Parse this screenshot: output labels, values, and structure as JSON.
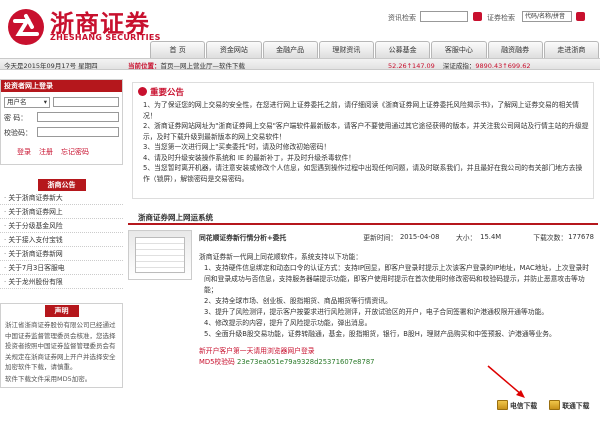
{
  "header": {
    "brand_cn": "浙商证券",
    "brand_en": "ZHESHANG SECURITIES",
    "search_info_label": "资讯检索",
    "search_code_label": "证券检索",
    "search_code_placeholder": "代码/名称/拼音"
  },
  "nav": {
    "tabs": [
      "首 页",
      "资金网站",
      "金融产品",
      "理财资讯",
      "公募基金",
      "客服中心",
      "融资融券",
      "走进浙商"
    ]
  },
  "topbar": {
    "date": "今天是2015年09月17号 星期四",
    "breadcrumb_label": "当前位置：",
    "breadcrumb_path": "首页—网上营业厅—软件下载",
    "ticker1": "52.26↑147.09",
    "ticker2_label": "深证成指：",
    "ticker2": "9890.43↑699.62"
  },
  "login": {
    "title": "投资者网上登录",
    "account_type": "用户名",
    "password_label": "密  码：",
    "captcha_label": "校验码：",
    "links": [
      "登录",
      "注册",
      "忘记密码"
    ]
  },
  "notices": {
    "title": "浙商公告",
    "items": [
      "关于浙商证券新大",
      "关于浙商证券网上",
      "关于分级基金风险",
      "关于接入支付宝钱",
      "关于浙商证券新网",
      "关于7月3日客服电",
      "关于龙州股份有限"
    ]
  },
  "statement": {
    "title": "声明",
    "body": "浙江省浙商证券股份有限公司已经通过中国证券监督管理委员会核准，您选择投资者按照中国证券监督管理委员会有关规定在浙商证券网上开户并选择安全加密软件下载，请慎重。",
    "md5_note": "软件下载文件采用MD5加密。"
  },
  "important": {
    "title": "重要公告",
    "items": [
      "1、为了保证您的网上交易的安全性，在您进行网上证券委托之前，请仔细阅读《浙商证券网上证券委托风险揭示书》，了解网上证券交易的相关情况！",
      "2、浙商证券网站网址为\"浙商证券网上交易\"客户端软件最新版本，请客户不要使用通过其它途径获得的版本，并关注我公司网站及行情主站的升级提示，及时下载升级到最新版本的网上交易软件！",
      "3、当您第一次进行网上\"买卖委托\"时，请及时修改初始密码！",
      "4、请及时升级安装操作系统和 IE 的最新补丁，并及时升级杀毒软件！",
      "5、当您暂时离开机器，请注意安装或修改个人信息，如您遇到操作过程中出现任何问题，请及时联系我们，并且最好在我公司的有关部门地方去操作（锁屏），解锁密码是交易密码。"
    ]
  },
  "software": {
    "tab_label": "浙商证券网上网运系统",
    "name": "同花顺证券新行情分析+委托",
    "updated_label": "更新时间：",
    "updated": "2015-04-08",
    "size_label": "大小：",
    "size": "15.4M",
    "downloads_label": "下载次数：",
    "downloads": "177678",
    "intro": "浙商证券新一代网上同花顺软件，系统支持以下功能：",
    "features": [
      "1、支持硬件信息绑定和动态口令的认证方式：支持IP回显，即客户登录时提示上次该客户登录的IP地址，MAC地址，上次登录时间和登录成功与否信息，支持服务器端提示功能，即客户使用时提示在首次使用时修改密码和校验码提示，并防止恶意攻击等功能；",
      "2、支持全球市场、创业板、股指期货、商品期货等行情资讯。",
      "3、提升了风险测评，提示客户按要求进行风险测评，开放试验区的开户，电子合同签署和沪港通权限开通等功能。",
      "4、修改提示的内容，提升了风险提示功能，弹出消息。",
      "5、全面升级B股交易功能，证券转融通，基金，股指期货，银行，B股H，理财产品购买和中签预报、沪港通等业务。"
    ],
    "new_user_note": "新开户客户第一天请用浏览器网户登录",
    "md5_label": "MD5校验码",
    "md5": "23e73ea051e79a9328d25371607e8787",
    "buttons": [
      "电信下载",
      "联通下载"
    ]
  },
  "colors": {
    "brand_red": "#c8102e",
    "nav_red": "#b5171c"
  }
}
